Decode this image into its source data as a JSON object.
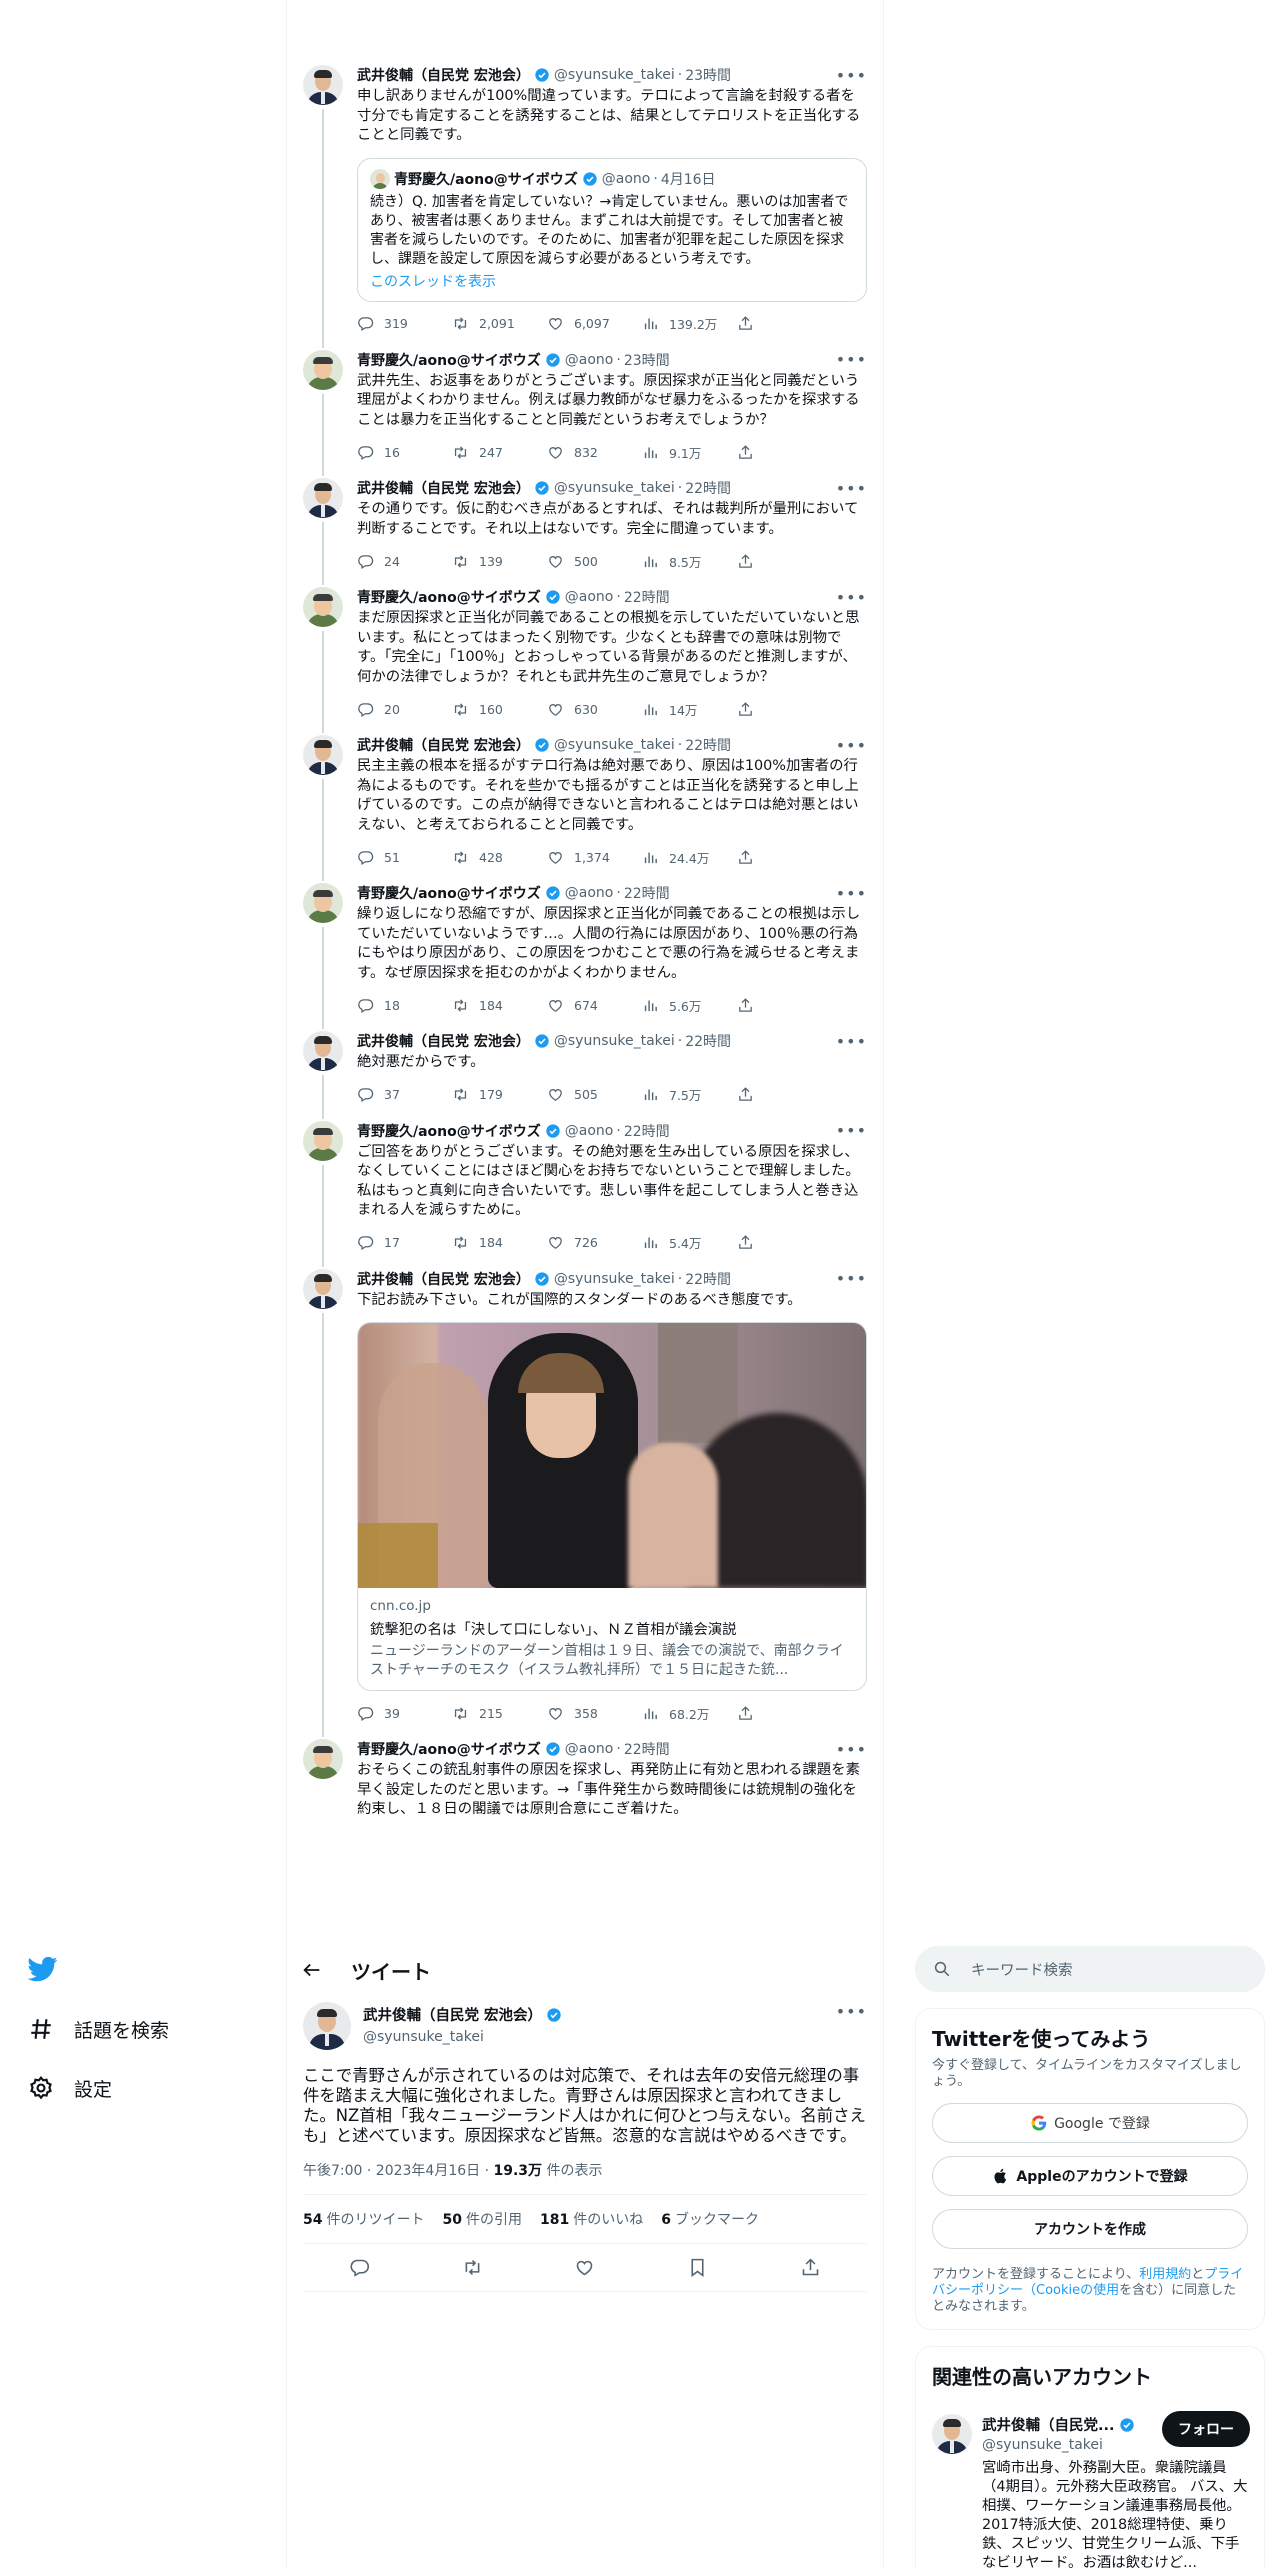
{
  "thread": [
    {
      "author": "takei",
      "name": "武井俊輔（自民党 宏池会）",
      "handle": "@syunsuke_takei",
      "time": "23時間",
      "text": "申し訳ありませんが100%間違っています。テロによって言論を封殺する者を寸分でも肯定することを誘発することは、結果としてテロリストを正当化することと同義です。",
      "quote": {
        "name": "青野慶久/aono@サイボウズ",
        "handle": "@aono",
        "time": "4月16日",
        "text": "続き）Q. 加害者を肯定していない？→肯定していません。悪いのは加害者であり、被害者は悪くありません。まずこれは大前提です。そして加害者と被害者を減らしたいのです。そのために、加害者が犯罪を起こした原因を探求し、課題を設定して原因を減らす必要があるという考えです。",
        "link": "このスレッドを表示"
      },
      "replies": "319",
      "retweets": "2,091",
      "likes": "6,097",
      "views": "139.2万"
    },
    {
      "author": "aono",
      "name": "青野慶久/aono@サイボウズ",
      "handle": "@aono",
      "time": "23時間",
      "text": "武井先生、お返事をありがとうございます。原因探求が正当化と同義だという理屈がよくわかりません。例えば暴力教師がなぜ暴力をふるったかを探求することは暴力を正当化することと同義だというお考えでしょうか？",
      "replies": "16",
      "retweets": "247",
      "likes": "832",
      "views": "9.1万"
    },
    {
      "author": "takei",
      "name": "武井俊輔（自民党 宏池会）",
      "handle": "@syunsuke_takei",
      "time": "22時間",
      "text": "その通りです。仮に酌むべき点があるとすれば、それは裁判所が量刑において判断することです。それ以上はないです。完全に間違っています。",
      "replies": "24",
      "retweets": "139",
      "likes": "500",
      "views": "8.5万"
    },
    {
      "author": "aono",
      "name": "青野慶久/aono@サイボウズ",
      "handle": "@aono",
      "time": "22時間",
      "text": "まだ原因探求と正当化が同義であることの根拠を示していただいていないと思います。私にとってはまったく別物です。少なくとも辞書での意味は別物です。「完全に」「100％」とおっしゃっている背景があるのだと推測しますが、何かの法律でしょうか？それとも武井先生のご意見でしょうか？",
      "replies": "20",
      "retweets": "160",
      "likes": "630",
      "views": "14万"
    },
    {
      "author": "takei",
      "name": "武井俊輔（自民党 宏池会）",
      "handle": "@syunsuke_takei",
      "time": "22時間",
      "text": "民主主義の根本を揺るがすテロ行為は絶対悪であり、原因は100%加害者の行為によるものです。それを些かでも揺るがすことは正当化を誘発すると申し上げているのです。この点が納得できないと言われることはテロは絶対悪とはいえない、と考えておられることと同義です。",
      "replies": "51",
      "retweets": "428",
      "likes": "1,374",
      "views": "24.4万"
    },
    {
      "author": "aono",
      "name": "青野慶久/aono@サイボウズ",
      "handle": "@aono",
      "time": "22時間",
      "text": "繰り返しになり恐縮ですが、原因探求と正当化が同義であることの根拠は示していただいていないようです…。人間の行為には原因があり、100％悪の行為にもやはり原因があり、この原因をつかむことで悪の行為を減らせると考えます。なぜ原因探求を拒むのかがよくわかりません。",
      "replies": "18",
      "retweets": "184",
      "likes": "674",
      "views": "5.6万"
    },
    {
      "author": "takei",
      "name": "武井俊輔（自民党 宏池会）",
      "handle": "@syunsuke_takei",
      "time": "22時間",
      "text": "絶対悪だからです。",
      "replies": "37",
      "retweets": "179",
      "likes": "505",
      "views": "7.5万"
    },
    {
      "author": "aono",
      "name": "青野慶久/aono@サイボウズ",
      "handle": "@aono",
      "time": "22時間",
      "text": "ご回答をありがとうございます。その絶対悪を生み出している原因を探求し、なくしていくことにはさほど関心をお持ちでないということで理解しました。私はもっと真剣に向き合いたいです。悲しい事件を起こしてしまう人と巻き込まれる人を減らすために。",
      "replies": "17",
      "retweets": "184",
      "likes": "726",
      "views": "5.4万"
    },
    {
      "author": "takei",
      "name": "武井俊輔（自民党 宏池会）",
      "handle": "@syunsuke_takei",
      "time": "22時間",
      "text": "下記お読み下さい。これが国際的スタンダードのあるべき態度です。",
      "card": {
        "domain": "cnn.co.jp",
        "title": "銃撃犯の名は「決して口にしない」、ＮＺ首相が議会演説",
        "desc": "ニュージーランドのアーダーン首相は１９日、議会での演説で、南部クライストチャーチのモスク（イスラム教礼拝所）で１５日に起きた銃..."
      },
      "replies": "39",
      "retweets": "215",
      "likes": "358",
      "views": "68.2万"
    },
    {
      "author": "aono",
      "name": "青野慶久/aono@サイボウズ",
      "handle": "@aono",
      "time": "22時間",
      "text": "おそらくこの銃乱射事件の原因を探求し、再発防止に有効と思われる課題を素早く設定したのだと思います。→「事件発生から数時間後には銃規制の強化を約束し、１８日の閣議では原則合意にこぎ着けた。",
      "replies": "",
      "retweets": "",
      "likes": "",
      "views": ""
    }
  ],
  "nav": {
    "explore": "話題を検索",
    "settings": "設定"
  },
  "main_tweet": {
    "header": "ツイート",
    "name": "武井俊輔（自民党 宏池会）",
    "handle": "@syunsuke_takei",
    "text": "ここで青野さんが示されているのは対応策で、それは去年の安倍元総理の事件を踏まえ大幅に強化されました。青野さんは原因探求と言われてきました。NZ首相「我々ニュージーランド人はかれに何ひとつ与えない。名前さえも」と述べています。原因探求など皆無。恣意的な言説はやめるべきです。",
    "time": "午後7:00 · 2023年4月16日 · ",
    "views_count": "19.3万",
    "views_label": " 件の表示",
    "stats": [
      {
        "n": "54",
        "label": "件のリツイート"
      },
      {
        "n": "50",
        "label": "件の引用"
      },
      {
        "n": "181",
        "label": "件のいいね"
      },
      {
        "n": "6",
        "label": "ブックマーク"
      }
    ]
  },
  "right": {
    "search_placeholder": "キーワード検索",
    "signup_title": "Twitterを使ってみよう",
    "signup_sub": "今すぐ登録して、タイムラインをカスタマイズしましょう。",
    "google_btn": "Google で登録",
    "apple_btn": "Appleのアカウントで登録",
    "create_btn": "アカウントを作成",
    "legal_1": "アカウントを登録することにより、",
    "legal_link1": "利用規約",
    "legal_2": "と",
    "legal_link2": "プライバシーポリシー（Cookieの使用",
    "legal_3": "を含む）に同意したとみなされます。",
    "related_title": "関連性の高いアカウント",
    "related_name": "武井俊輔（自民党...",
    "related_handle": "@syunsuke_takei",
    "follow_btn": "フォロー",
    "related_bio": "宮崎市出身、外務副大臣。衆議院議員（4期目）。元外務大臣政務官。 バス、大相撲、ワーケーション議連事務局長他。2017特派大使、2018総理特使、乗り鉄、スピッツ、甘党生クリーム派、下手なビリヤード。お酒は飲むけど..."
  }
}
